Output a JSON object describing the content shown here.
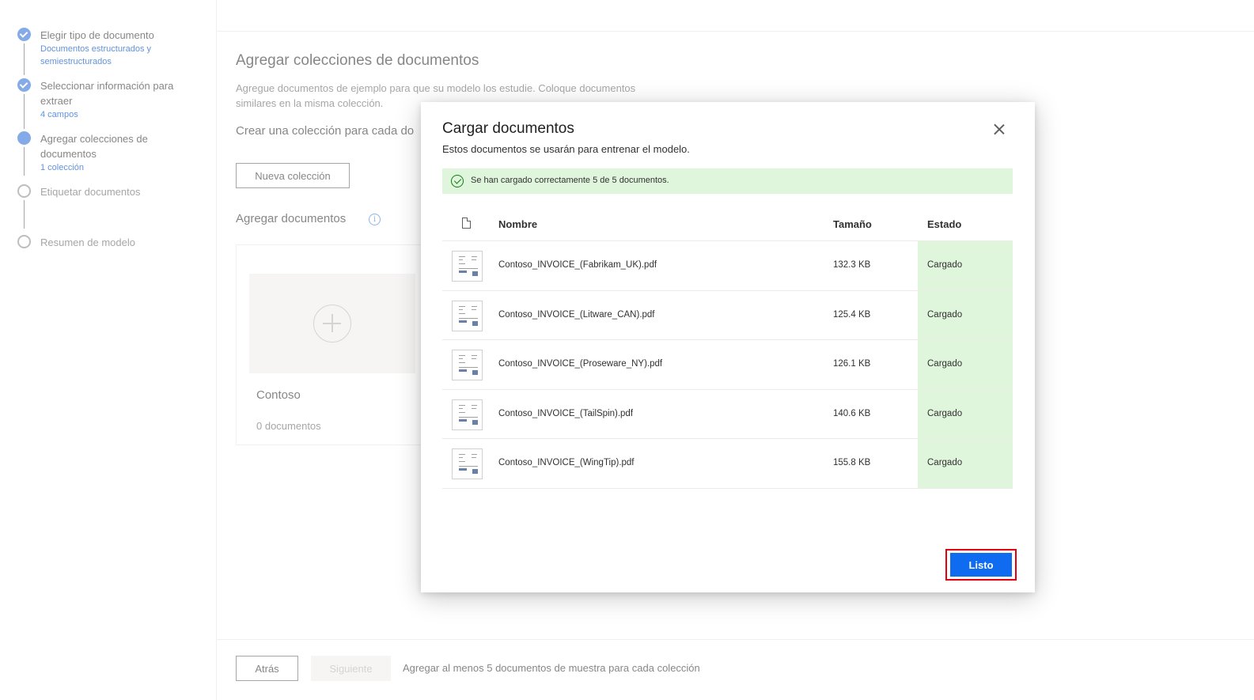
{
  "sidebar": {
    "steps": [
      {
        "title": "Elegir tipo de documento",
        "sub": "Documentos estructurados y semiestructurados",
        "state": "done"
      },
      {
        "title": "Seleccionar información para extraer",
        "sub": "4 campos",
        "state": "done"
      },
      {
        "title": "Agregar colecciones de documentos",
        "sub": "1 colección",
        "state": "current"
      },
      {
        "title": "Etiquetar documentos",
        "sub": "",
        "state": "todo"
      },
      {
        "title": "Resumen de modelo",
        "sub": "",
        "state": "todo"
      }
    ]
  },
  "main": {
    "title": "Agregar colecciones de documentos",
    "description": "Agregue documentos de ejemplo para que su modelo los estudie. Coloque documentos similares en la misma colección.",
    "subtitle": "Crear una colección para cada do",
    "new_collection_button": "Nueva colección",
    "add_documents_label": "Agregar documentos",
    "info_icon": "i",
    "collection_card": {
      "name": "Contoso",
      "count": "0 documentos"
    }
  },
  "footer": {
    "back_button": "Atrás",
    "next_button": "Siguiente",
    "message": "Agregar al menos 5 documentos de muestra para cada colección"
  },
  "dialog": {
    "title": "Cargar documentos",
    "description": "Estos documentos se usarán para entrenar el modelo.",
    "success_message": "Se han cargado correctamente 5 de 5 documentos.",
    "columns": {
      "name": "Nombre",
      "size": "Tamaño",
      "status": "Estado"
    },
    "files": [
      {
        "name": "Contoso_INVOICE_(Fabrikam_UK).pdf",
        "size": "132.3 KB",
        "status": "Cargado"
      },
      {
        "name": "Contoso_INVOICE_(Litware_CAN).pdf",
        "size": "125.4 KB",
        "status": "Cargado"
      },
      {
        "name": "Contoso_INVOICE_(Proseware_NY).pdf",
        "size": "126.1 KB",
        "status": "Cargado"
      },
      {
        "name": "Contoso_INVOICE_(TailSpin).pdf",
        "size": "140.6 KB",
        "status": "Cargado"
      },
      {
        "name": "Contoso_INVOICE_(WingTip).pdf",
        "size": "155.8 KB",
        "status": "Cargado"
      }
    ],
    "done_button": "Listo"
  },
  "colors": {
    "accent": "#0f6cf0",
    "success_bg": "#dff6dd",
    "success_icon": "#107c10",
    "highlight_border": "#e0000e"
  }
}
